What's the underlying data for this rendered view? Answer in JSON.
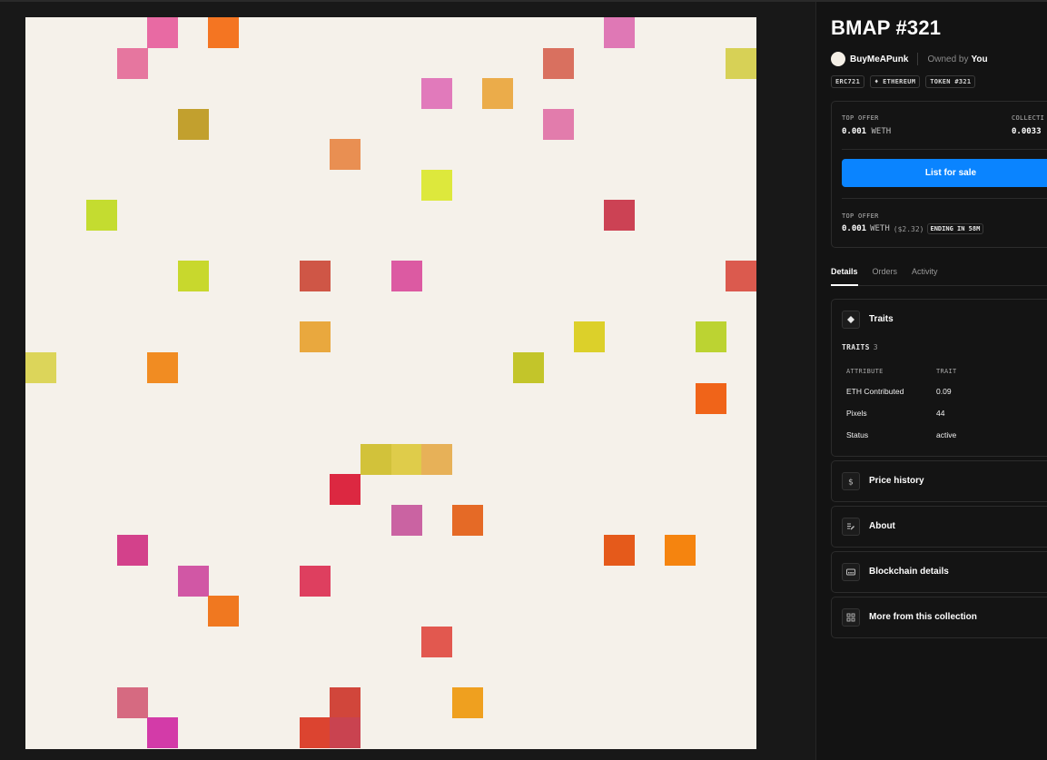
{
  "title": "BMAP #321",
  "creator": "BuyMeAPunk",
  "owned_by_label": "Owned by",
  "owned_by_value": "You",
  "badges": [
    "ERC721",
    "♦ ETHEREUM",
    "TOKEN #321"
  ],
  "offer_card": {
    "top_offer_label": "TOP OFFER",
    "top_offer_value": "0.001",
    "top_offer_unit": "WETH",
    "collection_label": "COLLECTI",
    "collection_value": "0.0033",
    "list_button": "List for sale",
    "top_offer_label_2": "TOP OFFER",
    "top_offer_value_2": "0.001",
    "top_offer_unit_2": "WETH",
    "top_offer_usd": "($2.32)",
    "ending_badge": "ENDING IN 58M"
  },
  "tabs": [
    "Details",
    "Orders",
    "Activity"
  ],
  "panels": {
    "traits": {
      "title": "Traits",
      "label": "TRAITS",
      "count": "3",
      "col_attribute": "ATTRIBUTE",
      "col_trait": "TRAIT",
      "rows": [
        {
          "attribute": "ETH Contributed",
          "trait": "0.09"
        },
        {
          "attribute": "Pixels",
          "trait": "44"
        },
        {
          "attribute": "Status",
          "trait": "active"
        }
      ]
    },
    "price_history": {
      "title": "Price history"
    },
    "about": {
      "title": "About"
    },
    "blockchain": {
      "title": "Blockchain details"
    },
    "more": {
      "title": "More from this collection"
    }
  },
  "icons": [
    "diamond-icon",
    "dollar-icon",
    "edit-icon",
    "blockchain-icon",
    "grid-icon"
  ],
  "artwork": {
    "background": "#f5f1ea",
    "grid_cells": 24,
    "pixels": [
      {
        "c": 4,
        "r": 0,
        "color": "#e86aa3"
      },
      {
        "c": 6,
        "r": 0,
        "color": "#f47522"
      },
      {
        "c": 19,
        "r": 0,
        "color": "#df78b5"
      },
      {
        "c": 3,
        "r": 1,
        "color": "#e6769f"
      },
      {
        "c": 17,
        "r": 1,
        "color": "#d9705f"
      },
      {
        "c": 23,
        "r": 1,
        "color": "#d7d156"
      },
      {
        "c": 13,
        "r": 2,
        "color": "#e17abb"
      },
      {
        "c": 15,
        "r": 2,
        "color": "#ebac4a"
      },
      {
        "c": 5,
        "r": 3,
        "color": "#c2a02e"
      },
      {
        "c": 17,
        "r": 3,
        "color": "#e27cac"
      },
      {
        "c": 10,
        "r": 4,
        "color": "#e98f52"
      },
      {
        "c": 13,
        "r": 5,
        "color": "#dde83c"
      },
      {
        "c": 2,
        "r": 6,
        "color": "#c4dc30"
      },
      {
        "c": 19,
        "r": 6,
        "color": "#cc4254"
      },
      {
        "c": 5,
        "r": 8,
        "color": "#c8d82d"
      },
      {
        "c": 9,
        "r": 8,
        "color": "#cf5646"
      },
      {
        "c": 12,
        "r": 8,
        "color": "#dc5aa2"
      },
      {
        "c": 23,
        "r": 8,
        "color": "#db5a4e"
      },
      {
        "c": 9,
        "r": 10,
        "color": "#e9a83e"
      },
      {
        "c": 18,
        "r": 10,
        "color": "#dcd02a"
      },
      {
        "c": 22,
        "r": 10,
        "color": "#bcd332"
      },
      {
        "c": 0,
        "r": 11,
        "color": "#dcd55a"
      },
      {
        "c": 4,
        "r": 11,
        "color": "#f18c22"
      },
      {
        "c": 16,
        "r": 11,
        "color": "#c3c52a"
      },
      {
        "c": 22,
        "r": 12,
        "color": "#f06419"
      },
      {
        "c": 11,
        "r": 14,
        "color": "#d2c23a"
      },
      {
        "c": 12,
        "r": 14,
        "color": "#dfcc4a"
      },
      {
        "c": 13,
        "r": 14,
        "color": "#e7b158"
      },
      {
        "c": 10,
        "r": 15,
        "color": "#dc2841"
      },
      {
        "c": 12,
        "r": 16,
        "color": "#ca63a2"
      },
      {
        "c": 14,
        "r": 16,
        "color": "#e56a26"
      },
      {
        "c": 3,
        "r": 17,
        "color": "#d3418b"
      },
      {
        "c": 19,
        "r": 17,
        "color": "#e55a1b"
      },
      {
        "c": 21,
        "r": 17,
        "color": "#f5840f"
      },
      {
        "c": 5,
        "r": 18,
        "color": "#d157a5"
      },
      {
        "c": 9,
        "r": 18,
        "color": "#de3f5f"
      },
      {
        "c": 6,
        "r": 19,
        "color": "#f07820"
      },
      {
        "c": 13,
        "r": 20,
        "color": "#e2584f"
      },
      {
        "c": 3,
        "r": 22,
        "color": "#d66a81"
      },
      {
        "c": 10,
        "r": 22,
        "color": "#d1463b"
      },
      {
        "c": 14,
        "r": 22,
        "color": "#efa01f"
      },
      {
        "c": 4,
        "r": 23,
        "color": "#d33ba8"
      },
      {
        "c": 9,
        "r": 23,
        "color": "#dc4430"
      },
      {
        "c": 10,
        "r": 23,
        "color": "#c94350"
      }
    ]
  }
}
